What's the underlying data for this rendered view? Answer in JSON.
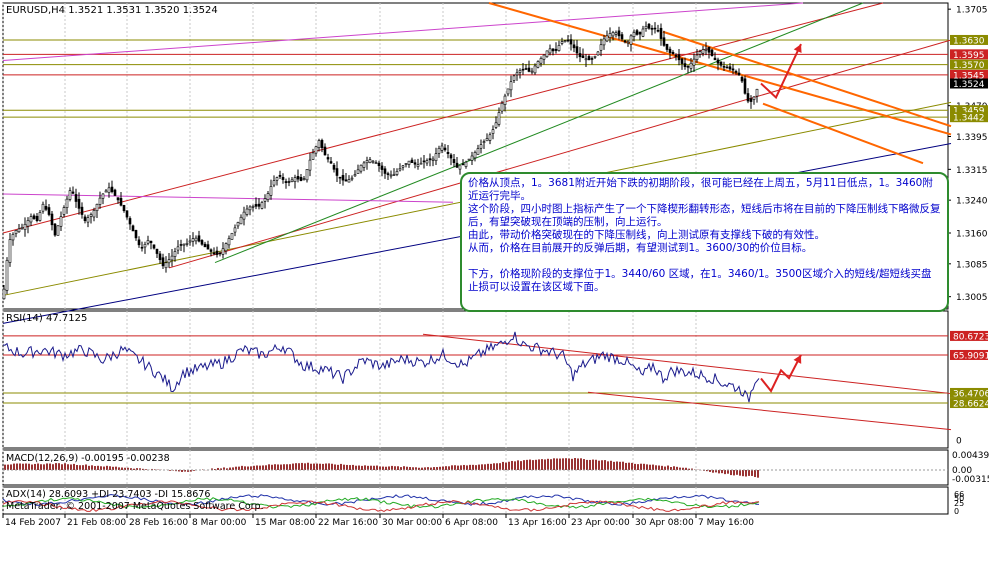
{
  "chart_data": {
    "type": "candlestick",
    "panes": [
      {
        "name": "price",
        "header": "EURUSD,H4  1.3521 1.3531 1.3520 1.3524",
        "ylim": [
          1.2975,
          1.372
        ],
        "axis_labels": [
          "1.3705",
          "1.3630",
          "1.3595",
          "1.3570",
          "1.3545",
          "1.3524",
          "1.3470",
          "1.3459",
          "1.3442",
          "1.3395",
          "1.3315",
          "1.3240",
          "1.3160",
          "1.3085",
          "1.3005"
        ],
        "highlight_labels": [
          {
            "text": "1.3630",
            "color": "#8b8b00"
          },
          {
            "text": "1.3595",
            "color": "#cc2222"
          },
          {
            "text": "1.3570",
            "color": "#8b8b00"
          },
          {
            "text": "1.3545",
            "color": "#cc2222"
          },
          {
            "text": "1.3524",
            "color": "#000000"
          },
          {
            "text": "1.3459",
            "color": "#8b8b00"
          },
          {
            "text": "1.3442",
            "color": "#8b8b00"
          }
        ],
        "horizontal_levels": [
          {
            "y": 1.363,
            "color": "#8b8b00"
          },
          {
            "y": 1.3595,
            "color": "#cc2222"
          },
          {
            "y": 1.357,
            "color": "#8b8b00"
          },
          {
            "y": 1.3545,
            "color": "#cc2222"
          },
          {
            "y": 1.3459,
            "color": "#8b8b00"
          },
          {
            "y": 1.3442,
            "color": "#8b8b00"
          }
        ]
      },
      {
        "name": "rsi",
        "header": "RSI(14) 47.7125",
        "ylim": [
          0,
          100
        ],
        "axis_labels": [
          "80.6723",
          "65.9091",
          "36.4706",
          "28.6624",
          "0"
        ],
        "levels": [
          80.6723,
          65.9091,
          36.4706,
          28.6624
        ],
        "current": 47.7125
      },
      {
        "name": "macd",
        "header": "MACD(12,26,9) -0.00195 -0.00238",
        "axis_labels": [
          "0.00439",
          "0.00",
          "-0.00315"
        ]
      },
      {
        "name": "adx",
        "header": "ADX(14) 28.6093 +DI 23.7403 -DI 15.8676",
        "axis_labels": [
          "66",
          "50",
          "25",
          "0"
        ]
      }
    ],
    "x_tick_labels": [
      "14 Feb 2007",
      "21 Feb 08:00",
      "28 Feb 16:00",
      "8 Mar 00:00",
      "15 Mar 08:00",
      "22 Mar 16:00",
      "30 Mar 00:00",
      "6 Apr 08:00",
      "13 Apr 16:00",
      "23 Apr 00:00",
      "30 Apr 08:00",
      "7 May 16:00"
    ],
    "price_path": [
      [
        0,
        1.3
      ],
      [
        6,
        1.314
      ],
      [
        12,
        1.3165
      ],
      [
        20,
        1.3175
      ],
      [
        28,
        1.32
      ],
      [
        34,
        1.319
      ],
      [
        40,
        1.323
      ],
      [
        46,
        1.3205
      ],
      [
        52,
        1.3155
      ],
      [
        60,
        1.3215
      ],
      [
        68,
        1.327
      ],
      [
        74,
        1.323
      ],
      [
        82,
        1.319
      ],
      [
        90,
        1.321
      ],
      [
        98,
        1.325
      ],
      [
        106,
        1.327
      ],
      [
        114,
        1.3245
      ],
      [
        122,
        1.321
      ],
      [
        130,
        1.3165
      ],
      [
        138,
        1.312
      ],
      [
        146,
        1.3145
      ],
      [
        154,
        1.311
      ],
      [
        160,
        1.308
      ],
      [
        168,
        1.31
      ],
      [
        176,
        1.313
      ],
      [
        184,
        1.3135
      ],
      [
        192,
        1.315
      ],
      [
        200,
        1.313
      ],
      [
        208,
        1.3115
      ],
      [
        216,
        1.3105
      ],
      [
        222,
        1.313
      ],
      [
        228,
        1.3155
      ],
      [
        236,
        1.319
      ],
      [
        242,
        1.3215
      ],
      [
        248,
        1.3225
      ],
      [
        256,
        1.3225
      ],
      [
        264,
        1.325
      ],
      [
        270,
        1.3285
      ],
      [
        276,
        1.33
      ],
      [
        284,
        1.328
      ],
      [
        292,
        1.3295
      ],
      [
        300,
        1.3285
      ],
      [
        308,
        1.3345
      ],
      [
        316,
        1.3385
      ],
      [
        322,
        1.335
      ],
      [
        328,
        1.333
      ],
      [
        334,
        1.33
      ],
      [
        342,
        1.3285
      ],
      [
        350,
        1.3295
      ],
      [
        358,
        1.3325
      ],
      [
        366,
        1.334
      ],
      [
        374,
        1.333
      ],
      [
        382,
        1.3305
      ],
      [
        390,
        1.33
      ],
      [
        398,
        1.332
      ],
      [
        406,
        1.3335
      ],
      [
        414,
        1.3325
      ],
      [
        422,
        1.3335
      ],
      [
        430,
        1.334
      ],
      [
        438,
        1.3375
      ],
      [
        446,
        1.335
      ],
      [
        454,
        1.332
      ],
      [
        462,
        1.333
      ],
      [
        470,
        1.335
      ],
      [
        478,
        1.3375
      ],
      [
        486,
        1.3395
      ],
      [
        492,
        1.342
      ],
      [
        498,
        1.347
      ],
      [
        504,
        1.3505
      ],
      [
        510,
        1.354
      ],
      [
        516,
        1.3555
      ],
      [
        522,
        1.356
      ],
      [
        528,
        1.355
      ],
      [
        534,
        1.3575
      ],
      [
        540,
        1.359
      ],
      [
        546,
        1.361
      ],
      [
        552,
        1.36
      ],
      [
        558,
        1.3625
      ],
      [
        564,
        1.363
      ],
      [
        570,
        1.3615
      ],
      [
        576,
        1.359
      ],
      [
        582,
        1.3585
      ],
      [
        588,
        1.358
      ],
      [
        594,
        1.3595
      ],
      [
        600,
        1.363
      ],
      [
        606,
        1.3645
      ],
      [
        612,
        1.365
      ],
      [
        618,
        1.3635
      ],
      [
        624,
        1.362
      ],
      [
        630,
        1.365
      ],
      [
        636,
        1.364
      ],
      [
        642,
        1.3665
      ],
      [
        648,
        1.3655
      ],
      [
        654,
        1.366
      ],
      [
        660,
        1.362
      ],
      [
        666,
        1.36
      ],
      [
        672,
        1.3595
      ],
      [
        678,
        1.3575
      ],
      [
        684,
        1.356
      ],
      [
        690,
        1.358
      ],
      [
        696,
        1.36
      ],
      [
        702,
        1.361
      ],
      [
        708,
        1.3595
      ],
      [
        714,
        1.3575
      ],
      [
        720,
        1.3565
      ],
      [
        726,
        1.356
      ],
      [
        732,
        1.3555
      ],
      [
        738,
        1.354
      ],
      [
        742,
        1.35
      ],
      [
        746,
        1.3475
      ],
      [
        750,
        1.3485
      ],
      [
        754,
        1.351
      ],
      [
        758,
        1.3524
      ]
    ],
    "projection_price": [
      [
        758,
        1.3524
      ],
      [
        773,
        1.349
      ],
      [
        798,
        1.362
      ]
    ],
    "rsi_path": [
      [
        0,
        72
      ],
      [
        20,
        67
      ],
      [
        40,
        70
      ],
      [
        60,
        66
      ],
      [
        80,
        70
      ],
      [
        100,
        62
      ],
      [
        120,
        70
      ],
      [
        140,
        60
      ],
      [
        160,
        48
      ],
      [
        170,
        40
      ],
      [
        180,
        52
      ],
      [
        200,
        56
      ],
      [
        220,
        60
      ],
      [
        240,
        70
      ],
      [
        260,
        66
      ],
      [
        280,
        73
      ],
      [
        300,
        58
      ],
      [
        320,
        55
      ],
      [
        340,
        48
      ],
      [
        360,
        62
      ],
      [
        380,
        57
      ],
      [
        400,
        63
      ],
      [
        420,
        60
      ],
      [
        440,
        66
      ],
      [
        460,
        58
      ],
      [
        480,
        68
      ],
      [
        500,
        75
      ],
      [
        510,
        82
      ],
      [
        520,
        74
      ],
      [
        540,
        70
      ],
      [
        560,
        65
      ],
      [
        570,
        50
      ],
      [
        580,
        58
      ],
      [
        600,
        66
      ],
      [
        620,
        62
      ],
      [
        640,
        50
      ],
      [
        650,
        58
      ],
      [
        660,
        48
      ],
      [
        670,
        54
      ],
      [
        690,
        52
      ],
      [
        710,
        48
      ],
      [
        720,
        44
      ],
      [
        730,
        42
      ],
      [
        740,
        38
      ],
      [
        745,
        30
      ],
      [
        750,
        42
      ],
      [
        756,
        47.7
      ]
    ],
    "rsi_projection": [
      [
        758,
        47.7
      ],
      [
        768,
        38
      ],
      [
        778,
        54
      ],
      [
        786,
        48
      ],
      [
        798,
        66
      ]
    ],
    "macd_hist": [
      [
        0,
        0.0018
      ],
      [
        60,
        0.002
      ],
      [
        120,
        0.0008
      ],
      [
        180,
        -0.0005
      ],
      [
        240,
        0.0012
      ],
      [
        300,
        0.0022
      ],
      [
        360,
        0.0014
      ],
      [
        420,
        0.0008
      ],
      [
        480,
        0.0018
      ],
      [
        520,
        0.003
      ],
      [
        560,
        0.0038
      ],
      [
        600,
        0.003
      ],
      [
        640,
        0.0018
      ],
      [
        680,
        0.0008
      ],
      [
        720,
        -0.0012
      ],
      [
        760,
        -0.0024
      ]
    ],
    "trendlines": {
      "price": [
        {
          "x1": 0,
          "y1": 1.3008,
          "x2": 948,
          "y2": 1.3478,
          "color": "#8b8b00",
          "w": 1
        },
        {
          "x1": 0,
          "y1": 1.294,
          "x2": 948,
          "y2": 1.3378,
          "color": "#000080",
          "w": 1
        },
        {
          "x1": 0,
          "y1": 1.316,
          "x2": 880,
          "y2": 1.372,
          "color": "#cc2222",
          "w": 1
        },
        {
          "x1": 166,
          "y1": 1.3075,
          "x2": 948,
          "y2": 1.363,
          "color": "#cc2222",
          "w": 1
        },
        {
          "x1": 212,
          "y1": 1.3088,
          "x2": 860,
          "y2": 1.372,
          "color": "#228b22",
          "w": 1
        },
        {
          "x1": 0,
          "y1": 1.358,
          "x2": 800,
          "y2": 1.372,
          "color": "#cc44cc",
          "w": 1
        },
        {
          "x1": 0,
          "y1": 1.3255,
          "x2": 450,
          "y2": 1.3235,
          "color": "#cc44cc",
          "w": 1
        },
        {
          "x1": 486,
          "y1": 1.372,
          "x2": 948,
          "y2": 1.34,
          "color": "#ff6600",
          "w": 2
        },
        {
          "x1": 660,
          "y1": 1.365,
          "x2": 948,
          "y2": 1.342,
          "color": "#ff6600",
          "w": 2
        },
        {
          "x1": 760,
          "y1": 1.3475,
          "x2": 920,
          "y2": 1.333,
          "color": "#ff6600",
          "w": 2
        }
      ],
      "rsi": [
        {
          "x1": 420,
          "y1": 82,
          "x2": 948,
          "y2": 36,
          "color": "#cc2222",
          "w": 1
        },
        {
          "x1": 585,
          "y1": 37,
          "x2": 948,
          "y2": 8,
          "color": "#cc2222",
          "w": 1
        }
      ]
    },
    "grid": true
  },
  "annotation": {
    "p1": "价格从顶点，1。3681附近开始下跌的初期阶段，很可能已经在上周五，5月11日低点，1。3460附近运行完毕。",
    "p2": "这个阶段，四小时图上指标产生了一个下降楔形翻转形态，短线后市将在目前的下降压制线下略微反复后，有望突破现在顶端的压制，向上运行。",
    "p3": "由此，带动价格突破现在的下降压制线，向上测试原有支撑线下破的有效性。",
    "p4": "从而，价格在目前展开的反弹后期，有望测试到1。3600/30的价位目标。",
    "p5": "下方，价格现阶段的支撑位于1。3440/60 区域，在1。3460/1。3500区域介入的短线/超短线买盘止损可以设置在该区域下面。"
  },
  "copyright": "MetaTrader, © 2001-2007 MetaQuotes Software Corp."
}
